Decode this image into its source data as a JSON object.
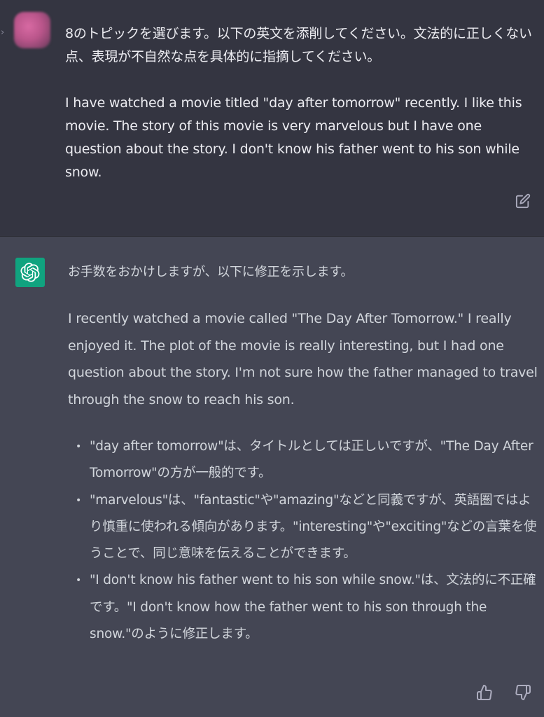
{
  "user_message": {
    "avatar_icon": "blurred-user-avatar-icon",
    "expand_icon": "chevron-right-icon",
    "prompt_line": "8のトピックを選びます。以下の英文を添削してください。文法的に正しくない点、表現が不自然な点を具体的に指摘してください。",
    "essay": "I have watched a movie titled \"day after tomorrow\" recently. I like this movie. The story of this movie is very marvelous but I have one question about the story. I don't know his father went to his son while snow.",
    "edit_icon": "edit-icon"
  },
  "assistant_message": {
    "avatar_icon": "openai-logo-icon",
    "intro": "お手数をおかけしますが、以下に修正を示します。",
    "corrected": "I recently watched a movie called \"The Day After Tomorrow.\" I really enjoyed it. The plot of the movie is really interesting, but I had one question about the story. I'm not sure how the father managed to travel through the snow to reach his son.",
    "bullets": [
      "\"day after tomorrow\"は、タイトルとしては正しいですが、\"The Day After Tomorrow\"の方が一般的です。",
      "\"marvelous\"は、\"fantastic\"や\"amazing\"などと同義ですが、英語圏ではより慎重に使われる傾向があります。\"interesting\"や\"exciting\"などの言葉を使うことで、同じ意味を伝えることができます。",
      "\"I don't know his father went to his son while snow.\"は、文法的に不正確です。\"I don't know how the father went to his son through the snow.\"のように修正します。"
    ],
    "bullet_glyph": "•",
    "feedback_icons": [
      "thumbs-up-icon",
      "thumbs-down-icon"
    ]
  },
  "colors": {
    "user_bg": "#343541",
    "assistant_bg": "#444654",
    "accent": "#10a37f"
  }
}
